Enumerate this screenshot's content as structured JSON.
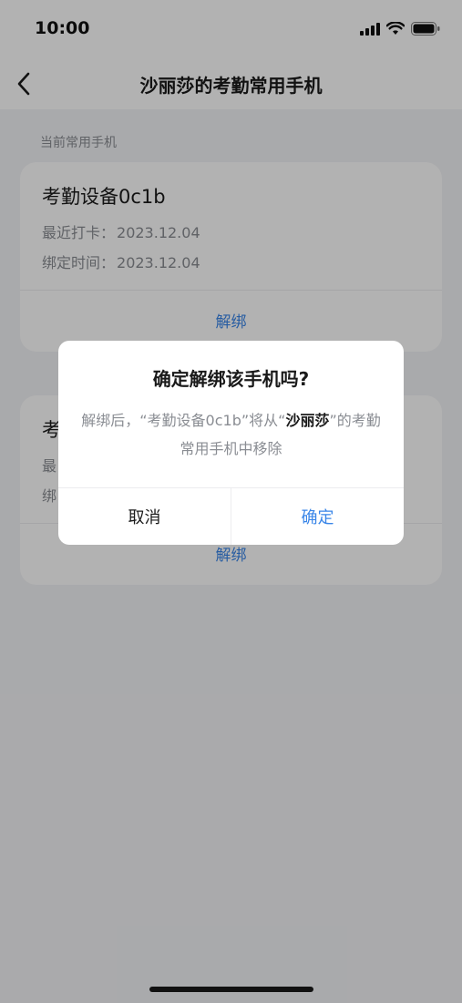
{
  "status_bar": {
    "time": "10:00"
  },
  "header": {
    "title": "沙丽莎的考勤常用手机"
  },
  "section": {
    "label": "当前常用手机"
  },
  "devices": [
    {
      "name": "考勤设备0c1b",
      "last_checkin_label": "最近打卡：",
      "last_checkin_value": "2023.12.04",
      "bind_time_label": "绑定时间：",
      "bind_time_value": "2023.12.04",
      "action": "解绑"
    },
    {
      "name": "考",
      "last_checkin_label": "最",
      "last_checkin_value": "",
      "bind_time_label": "绑",
      "bind_time_value": "",
      "action": "解绑"
    }
  ],
  "dialog": {
    "title": "确定解绑该手机吗?",
    "message_prefix": "解绑后，“考勤设备0c1b”将从“",
    "message_highlight": "沙丽莎",
    "message_suffix": "”的考勤常用手机中移除",
    "cancel": "取消",
    "confirm": "确定"
  },
  "colors": {
    "accent": "#3a86e8",
    "overlay": "rgba(0,0,0,0.30)",
    "background": "#f3f4f6"
  },
  "icons": {
    "back": "chevron-left-icon",
    "signal": "cellular-signal-icon",
    "wifi": "wifi-icon",
    "battery": "battery-icon"
  }
}
